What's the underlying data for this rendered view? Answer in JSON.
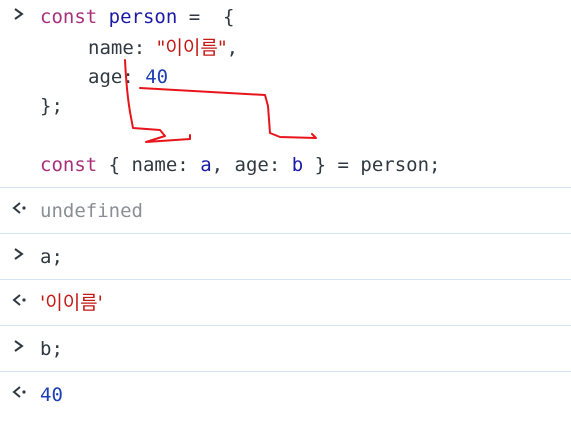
{
  "input_block": {
    "line1": {
      "kw": "const",
      "var": "person",
      "rest": " =  {"
    },
    "line2": {
      "key": "name",
      "colon": ": ",
      "value": "\"이이름\"",
      "comma": ","
    },
    "line3": {
      "key": "age",
      "colon": ": ",
      "value": "40"
    },
    "line4": "};",
    "line6": {
      "kw": "const",
      "open": " { ",
      "k1": "name",
      "c1": ": ",
      "v1": "a",
      "comma": ", ",
      "k2": "age",
      "c2": ": ",
      "v2": "b",
      "close": " } = person;"
    }
  },
  "outputs": {
    "result1": "undefined",
    "input2": "a;",
    "result2": "'이이름'",
    "input3": "b;",
    "result3": "40"
  },
  "glyphs": {
    "input": "›",
    "result": "‹·"
  },
  "colors": {
    "keyword": "#a8307b",
    "variable": "#1a1aa6",
    "string": "#c41a16",
    "number": "#1c3fb5",
    "annotation": "#e8141b",
    "row_border": "#d5e3f5"
  }
}
